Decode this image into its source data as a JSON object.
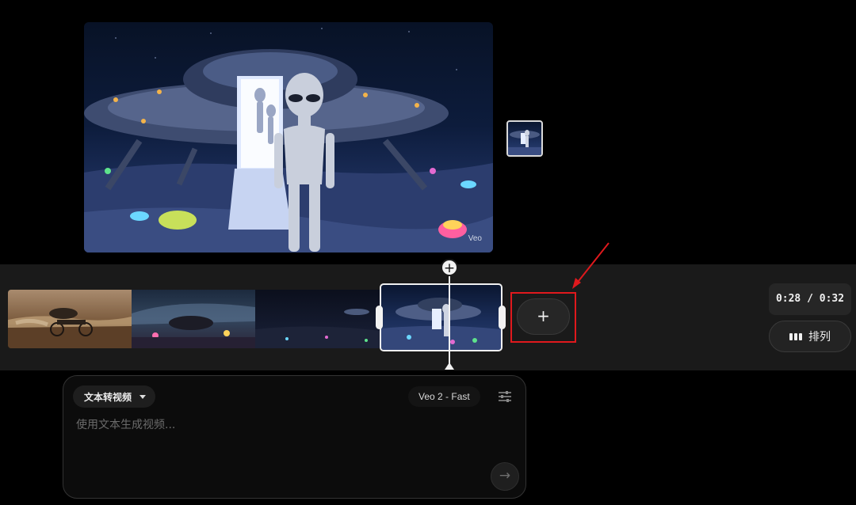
{
  "preview": {
    "watermark": "Veo",
    "scene_icon": "alien-ufo-scene"
  },
  "timeline": {
    "clips": [
      {
        "name": "clip-desert-rider"
      },
      {
        "name": "clip-night-street"
      },
      {
        "name": "clip-dark-moonscape"
      },
      {
        "name": "clip-ufo-alien",
        "selected": true
      }
    ],
    "playhead_add_label": "+",
    "add_clip_label": "+",
    "time": "0:28 / 0:32",
    "arrange_label": "排列"
  },
  "prompt": {
    "mode": "文本转视频",
    "model": "Veo 2 - Fast",
    "placeholder": "使用文本生成视频...",
    "submit_icon": "→"
  },
  "colors": {
    "annotation": "#e0191d",
    "panel_bg": "#1a1a1a"
  }
}
